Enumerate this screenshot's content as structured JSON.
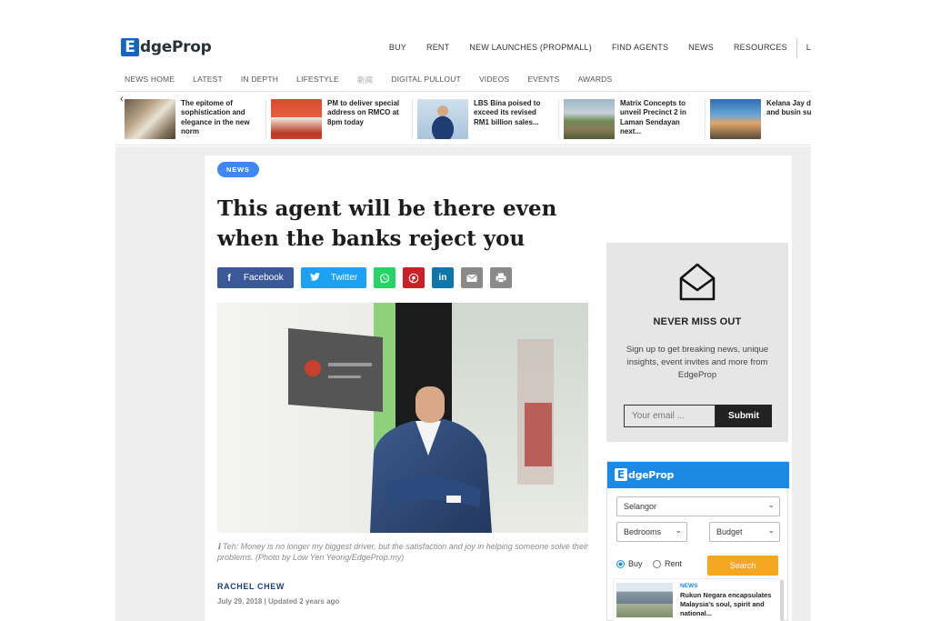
{
  "brand": {
    "name": "EdgeProp",
    "logo_letter": "E",
    "logo_rest": "dgeProp"
  },
  "main_nav": [
    "BUY",
    "RENT",
    "NEW LAUNCHES (PROPMALL)",
    "FIND AGENTS",
    "NEWS",
    "RESOURCES",
    "L"
  ],
  "sub_nav": [
    "NEWS HOME",
    "LATEST",
    "IN DEPTH",
    "LIFESTYLE",
    "新闻",
    "DIGITAL PULLOUT",
    "VIDEOS",
    "EVENTS",
    "AWARDS"
  ],
  "ticker": {
    "arrow": "‹",
    "items": [
      {
        "title": "The epitome of sophistication and elegance in the new norm"
      },
      {
        "title": "PM to deliver special address on RMCO at 8pm today"
      },
      {
        "title": "LBS Bina poised to exceed its revised RM1 billion sales..."
      },
      {
        "title": "Matrix Concepts to unveil Precinct 2 in Laman Sendayan next..."
      },
      {
        "title": "Kelana Jay dynamic h and busin suburb"
      }
    ]
  },
  "article": {
    "category": "NEWS",
    "headline": "This agent will be there even when the banks reject you",
    "share": {
      "facebook": "Facebook",
      "twitter": "Twitter"
    },
    "caption": "ℹ Teh: Money is no longer my biggest driver, but the satisfaction and joy in helping someone solve their problems. (Photo by Low Yen Yeong/EdgeProp.my)",
    "author": "RACHEL CHEW",
    "date": "July 29, 2018 | Updated 2 years ago"
  },
  "newsletter": {
    "title": "NEVER MISS OUT",
    "body": "Sign up to get breaking news, unique insights, event invites and more from EdgeProp",
    "email_placeholder": "Your email ...",
    "submit_label": "Submit"
  },
  "search_widget": {
    "brand_letter": "E",
    "brand_rest": "dgeProp",
    "state": "Selangor",
    "bedrooms": "Bedrooms",
    "budget": "Budget",
    "buy_label": "Buy",
    "rent_label": "Rent",
    "selected_mode": "Buy",
    "search_label": "Search",
    "news": {
      "tag": "NEWS",
      "title": "Rukun Negara encapsulates Malaysia's soul, spirit and national..."
    }
  },
  "colors": {
    "accent": "#1e88e5",
    "badge": "#3f87f5",
    "search_button": "#f5a623",
    "facebook": "#3b5998",
    "twitter": "#1da1f2"
  }
}
